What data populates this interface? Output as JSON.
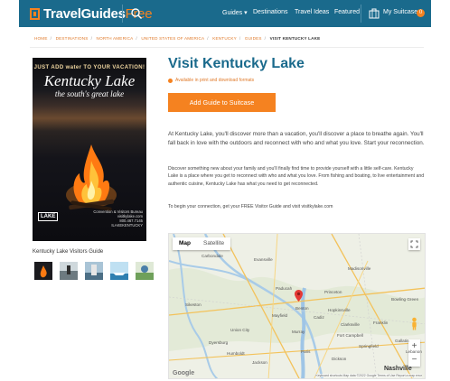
{
  "nav": {
    "logo_main": "TravelGuides",
    "logo_accent": "Free",
    "items": [
      "Guides ▾",
      "Destinations",
      "Travel Ideas",
      "Featured"
    ],
    "suitcase_label": "My Suitcase",
    "suitcase_count": "0"
  },
  "breadcrumb": [
    "HOME",
    "DESTINATIONS",
    "NORTH AMERICA",
    "UNITED STATES OF AMERICA",
    "KENTUCKY",
    "GUIDES",
    "VISIT KENTUCKY LAKE"
  ],
  "guide": {
    "cover_tagline": "JUST ADD water TO YOUR VACATION!",
    "cover_title": "Kentucky Lake",
    "cover_subtitle": "the south's great lake",
    "cover_lake_badge": "LAKE",
    "cover_info": "Convention & Visitors Bureau\nvisitkylake.com\n800.467.7145\nILAKEKENTUCKY",
    "caption": "Kentucky Lake Visitors Guide"
  },
  "main": {
    "title": "Visit Kentucky Lake",
    "availability": "Available in print and download formats",
    "add_button": "Add Guide to Suitcase",
    "paragraph_1": "At Kentucky Lake, you'll discover more than a vacation, you'll discover a place to breathe again. You'll fall back in love with the outdoors and reconnect with who and what you love. Start your reconnection.",
    "paragraph_2": "Discover something new about your family and you'll finally find time to provide yourself with a little self-care. Kentucky Lake is a place where you get to reconnect with who and what you love. From fishing and boating, to live entertainment and authentic cuisine, Kentucky Lake has what you need to get reconnected.",
    "paragraph_3": "To begin your connection, get your FREE Visitor Guide and visit visitkylake.com"
  },
  "map": {
    "tab_map": "Map",
    "tab_satellite": "Satellite",
    "zoom_in": "+",
    "zoom_out": "−",
    "google": "Google",
    "legal": "Keyboard shortcuts   Map data ©2022 Google   Terms of Use   Report a map error",
    "places": [
      "Carbondale",
      "Madisonville",
      "Hopkinsville",
      "Paducah",
      "Princeton",
      "Clarksville",
      "Bowling Green",
      "Benton",
      "Mayfield",
      "Murray",
      "Paris",
      "Fort Campbell",
      "Nashville",
      "Dyersburg",
      "Union City",
      "Cadiz",
      "Franklin",
      "Springfield",
      "Dickson",
      "Gallatin",
      "Jackson",
      "Humboldt",
      "Lebanon",
      "Sikeston",
      "Evansville"
    ]
  },
  "colors": {
    "brand_blue": "#1a6a8c",
    "accent_orange": "#f58220"
  }
}
